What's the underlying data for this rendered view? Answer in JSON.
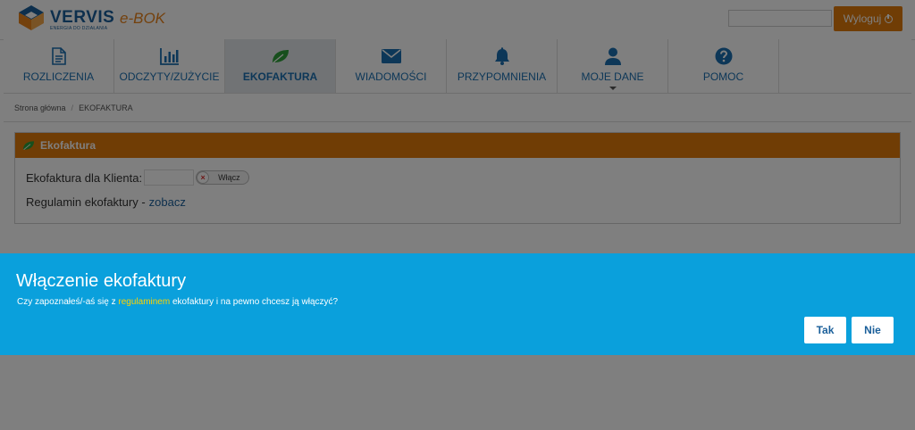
{
  "header": {
    "logo_text": "VERVIS",
    "logo_tagline": "ENERGIA DO DZIAŁANIA",
    "app_name": "e-BOK",
    "user_value": "",
    "logout_label": "Wyloguj"
  },
  "nav": {
    "items": [
      {
        "label": "ROZLICZENIA",
        "icon": "document-icon"
      },
      {
        "label": "ODCZYTY/ZUŻYCIE",
        "icon": "bar-chart-icon"
      },
      {
        "label": "EKOFAKTURA",
        "icon": "leaf-icon",
        "active": true
      },
      {
        "label": "WIADOMOŚCI",
        "icon": "envelope-icon"
      },
      {
        "label": "PRZYPOMNIENIA",
        "icon": "bell-icon"
      },
      {
        "label": "MOJE DANE",
        "icon": "user-icon"
      },
      {
        "label": "POMOC",
        "icon": "help-icon"
      }
    ]
  },
  "breadcrumb": {
    "home": "Strona główna",
    "separator": "/",
    "current": "EKOFAKTURA"
  },
  "panel": {
    "title": "Ekofaktura",
    "client_label": "Ekofaktura dla Klienta:",
    "client_value": "",
    "toggle_label": "Włącz",
    "terms_label": "Regulamin ekofaktury -",
    "terms_link": "zobacz"
  },
  "modal": {
    "title": "Włączenie ekofaktury",
    "text_before": "Czy zapoznałeś/-aś się z ",
    "text_link": "regulaminem",
    "text_after": " ekofaktury i na pewno chcesz ją włączyć?",
    "yes_label": "Tak",
    "no_label": "Nie"
  },
  "colors": {
    "accent_orange": "#e07b0b",
    "brand_blue": "#1a5f9a",
    "modal_blue": "#0aa0dc",
    "link_yellow": "#ffd200"
  }
}
